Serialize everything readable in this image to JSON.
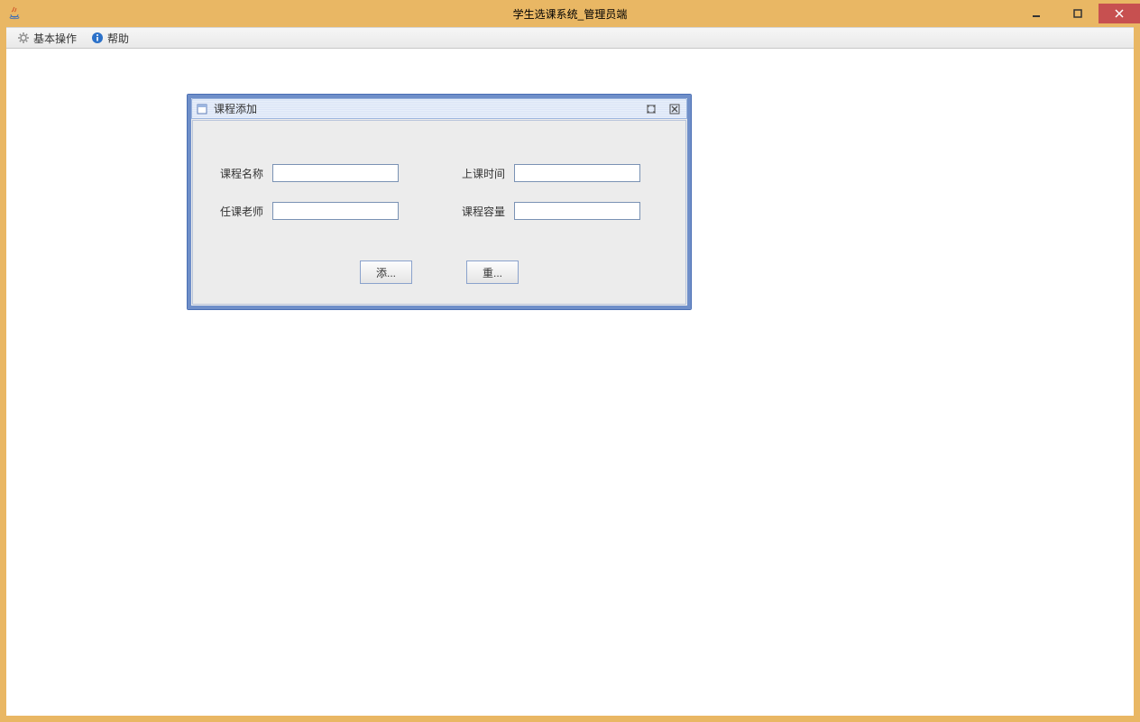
{
  "window": {
    "title": "学生选课系统_管理员端"
  },
  "menubar": {
    "basic_ops": "基本操作",
    "help": "帮助"
  },
  "internal_frame": {
    "title": "课程添加",
    "fields": {
      "course_name_label": "课程名称",
      "course_name_value": "",
      "class_time_label": "上课时间",
      "class_time_value": "",
      "instructor_label": "任课老师",
      "instructor_value": "",
      "capacity_label": "课程容量",
      "capacity_value": ""
    },
    "buttons": {
      "add": "添...",
      "reset": "重..."
    }
  }
}
